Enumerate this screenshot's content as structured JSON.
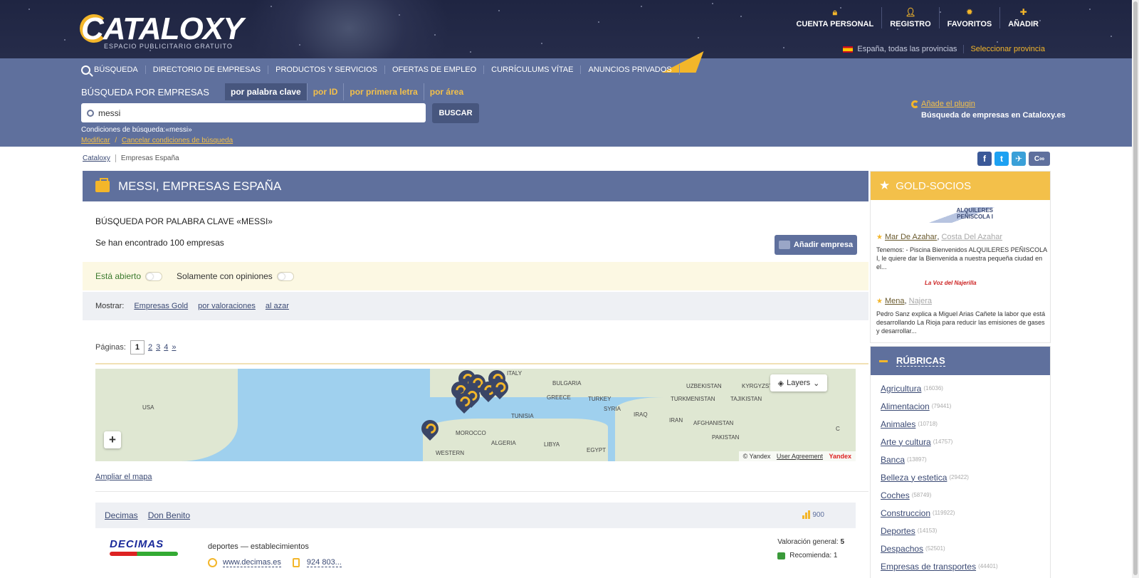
{
  "brand": {
    "name": "CATALOXY",
    "tagline": "ESPACIO PUBLICITARIO GRATUITO"
  },
  "top_nav": [
    {
      "label": "CUENTA PERSONAL",
      "icon": "lock-icon"
    },
    {
      "label": "REGISTRO",
      "icon": "user-icon"
    },
    {
      "label": "FAVORITOS",
      "icon": "star-icon"
    },
    {
      "label": "AÑADIR",
      "icon": "plus-icon"
    }
  ],
  "region": {
    "current": "España, todas las provincias",
    "select": "Seleccionar provincia"
  },
  "main_nav": [
    "BÚSQUEDA",
    "DIRECTORIO DE EMPRESAS",
    "PRODUCTOS Y SERVICIOS",
    "OFERTAS DE EMPLEO",
    "CURRÍCULUMS VÍTAE",
    "ANUNCIOS PRIVADOS"
  ],
  "search": {
    "title": "BÚSQUEDA POR EMPRESAS",
    "modes": [
      "por palabra clave",
      "por ID",
      "por primera letra",
      "por área"
    ],
    "value": "messi",
    "button": "BUSCAR",
    "conditions": "Condiciones de búsqueda:«messi»",
    "modify": "Modificar",
    "slash": "/",
    "cancel": "Cancelar  condiciones de búsqueda"
  },
  "plugin": {
    "link": "Añade el plugin",
    "sub": "Búsqueda de empresas en Cataloxy.es"
  },
  "breadcrumb": {
    "root": "Cataloxy",
    "current": "Empresas España"
  },
  "share": [
    "f",
    "t",
    "✈",
    "C∞"
  ],
  "colors": {
    "accent": "#f3b62a",
    "brand_blue": "#5f709d",
    "dark_header": "#262c4a",
    "link": "#3b4a74"
  },
  "panel": {
    "title": "MESSI, EMPRESAS ESPAÑA",
    "keyword_title": "BÚSQUEDA POR PALABRA CLAVE «MESSI»",
    "found": "Se han encontrado 100 empresas",
    "add_button": "Añadir empresa",
    "filter_open": "Está abierto",
    "filter_reviews": "Solamente con opiniones",
    "show_label": "Mostrar:",
    "show_links": [
      "Empresas Gold",
      "por valoraciones",
      "al azar"
    ],
    "pages_label": "Páginas:",
    "pages": [
      "1",
      "2",
      "3",
      "4",
      "»"
    ],
    "map": {
      "labels": [
        "USA",
        "ITALY",
        "BULGARIA",
        "GREECE",
        "TURKEY",
        "UZBEKISTAN",
        "TURKMENISTAN",
        "KYRGYZSTAN",
        "TAJIKISTAN",
        "TUNISIA",
        "SYRIA",
        "IRAQ",
        "IRAN",
        "AFGHANISTAN",
        "PAKISTAN",
        "MOROCCO",
        "ALGERIA",
        "LIBYA",
        "EGYPT",
        "WESTERN",
        "C"
      ],
      "layers": "Layers",
      "zoom": "+",
      "copyright": "© Yandex",
      "agreement": "User Agreement",
      "logo": "Yandex"
    },
    "expand_map": "Ampliar el mapa"
  },
  "result": {
    "company": "Decimas",
    "city": "Don Benito",
    "score": "900",
    "logo_text": "DECIMAS",
    "category": "deportes — establecimientos",
    "website": "www.decimas.es",
    "phone": "924 803...",
    "rating_label": "Valoración general:",
    "rating": "5",
    "recommend": "Recomienda: 1"
  },
  "gold": {
    "title": "GOLD-SOCIOS",
    "logo1": "ALQUILERES PEÑISCOLA I",
    "logo2": "La Voz del Najerilla",
    "items": [
      {
        "company": "Mar De Azahar",
        "city": "Costa Del Azahar",
        "desc": "Tenemos: - Piscina Bienvenidos ALQUILERES PEÑISCOLA I, le quiere dar la Bienvenida a nuestra pequeña ciudad en el..."
      },
      {
        "company": "Mena",
        "city": "Najera",
        "desc": "Pedro Sanz explica a Miguel Arias Cañete la labor que está desarrollando La Rioja para reducir las emisiones de gases y desarrollar..."
      }
    ]
  },
  "rubricas": {
    "title": "RÚBRICAS",
    "items": [
      {
        "name": "Agricultura",
        "count": "(16036)"
      },
      {
        "name": "Alimentacion",
        "count": "(79441)"
      },
      {
        "name": "Animales",
        "count": "(10718)"
      },
      {
        "name": "Arte y cultura",
        "count": "(14757)"
      },
      {
        "name": "Banca",
        "count": "(13897)"
      },
      {
        "name": "Belleza y estetica",
        "count": "(29422)"
      },
      {
        "name": "Coches",
        "count": "(58749)"
      },
      {
        "name": "Construccion",
        "count": "(119922)"
      },
      {
        "name": "Deportes",
        "count": "(14153)"
      },
      {
        "name": "Despachos",
        "count": "(52501)"
      },
      {
        "name": "Empresas de transportes",
        "count": "(44401)"
      }
    ]
  }
}
